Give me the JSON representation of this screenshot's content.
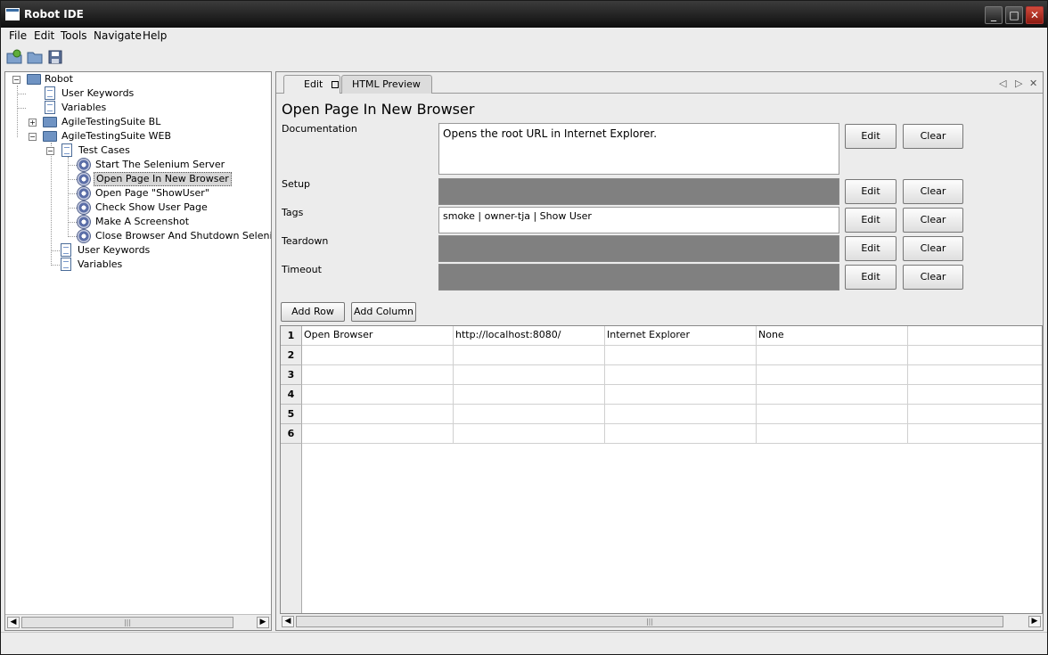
{
  "window": {
    "title": "Robot IDE",
    "min": "_",
    "max": "□",
    "close": "✕"
  },
  "menu": [
    "File",
    "Edit",
    "Tools",
    "Navigate",
    "Help"
  ],
  "tree": {
    "root": "Robot",
    "root_children": [
      "User Keywords",
      "Variables"
    ],
    "suite_bl": "AgileTestingSuite BL",
    "suite_web": "AgileTestingSuite WEB",
    "test_cases_label": "Test Cases",
    "test_cases": [
      "Start The Selenium Server",
      "Open Page In New Browser",
      "Open Page \"ShowUser\"",
      "Check Show User Page",
      "Make A Screenshot",
      "Close Browser And Shutdown Selenium Server"
    ],
    "web_children": [
      "User Keywords",
      "Variables"
    ]
  },
  "tabs": {
    "edit": "Edit",
    "preview": "HTML Preview"
  },
  "editor": {
    "title": "Open Page In New Browser",
    "documentation_label": "Documentation",
    "documentation_value": "Opens the root URL in Internet Explorer.",
    "setup_label": "Setup",
    "tags_label": "Tags",
    "tags_value": "smoke | owner-tja | Show User",
    "teardown_label": "Teardown",
    "timeout_label": "Timeout",
    "edit_label": "Edit",
    "clear_label": "Clear",
    "add_row": "Add Row",
    "add_column": "Add Column"
  },
  "grid": {
    "row_numbers": [
      "1",
      "2",
      "3",
      "4",
      "5",
      "6"
    ],
    "row1": [
      "Open Browser",
      "http://localhost:8080/",
      "Internet Explorer",
      "None",
      ""
    ]
  },
  "colors": {
    "titlebar": "#1a1a1a",
    "disabled_field": "#808080",
    "selection": "#d6d6d6"
  }
}
